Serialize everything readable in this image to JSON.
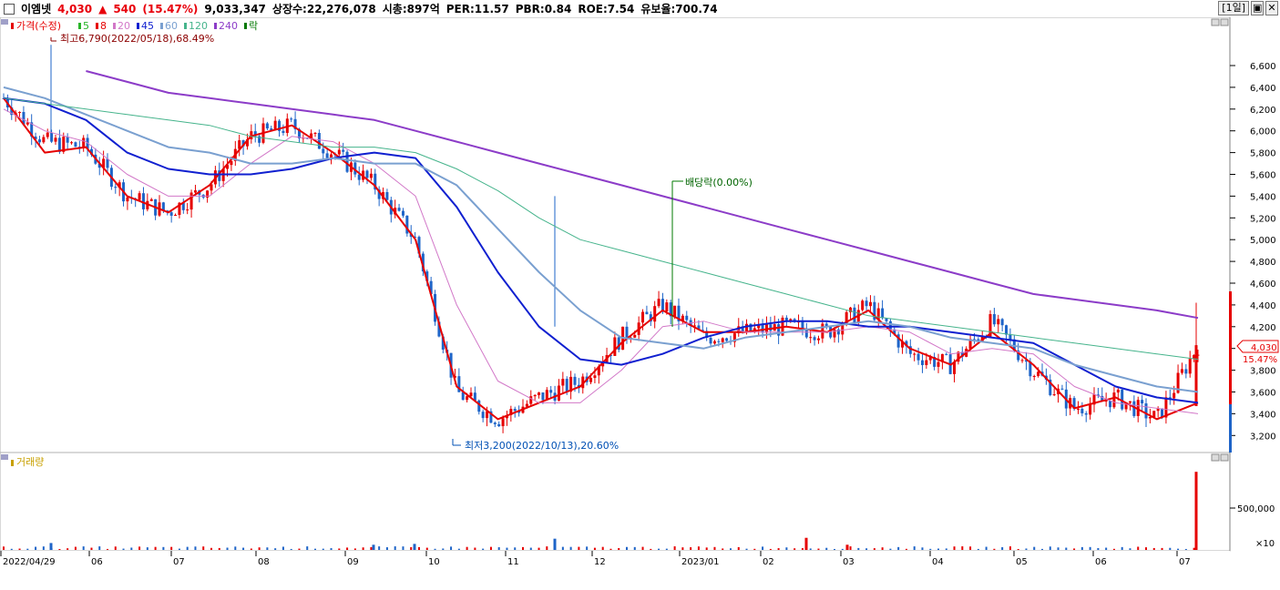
{
  "header": {
    "stock_name": "이엠넷",
    "price": "4,030",
    "change_arrow": "▲",
    "change": "540",
    "change_pct": "(15.47%)",
    "volume": "9,033,347",
    "listed_shares": "상장수:22,276,078",
    "market_cap": "시총:897억",
    "per": "PER:11.57",
    "pbr": "PBR:0.84",
    "roe": "ROE:7.54",
    "reserve_ratio": "유보율:700.74",
    "period_button": "[1일]",
    "restore_button": "▣",
    "close_button": "✕"
  },
  "legend": {
    "price_label": "가격(수정)",
    "ma_items": [
      {
        "label": "5",
        "color": "#28b428"
      },
      {
        "label": "8",
        "color": "#e60000"
      },
      {
        "label": "20",
        "color": "#d278c8"
      },
      {
        "label": "45",
        "color": "#1020d0"
      },
      {
        "label": "60",
        "color": "#7aa0d0"
      },
      {
        "label": "120",
        "color": "#46b48c"
      },
      {
        "label": "240",
        "color": "#8c3cc8"
      }
    ],
    "rak_label": "락",
    "volume_label": "거래량"
  },
  "annotations": {
    "high": "최고6,790(2022/05/18),68.49%",
    "low": "최저3,200(2022/10/13),20.60%",
    "dividend": "배당락(0.00%)"
  },
  "price_axis": {
    "ticks": [
      "6,600",
      "6,400",
      "6,200",
      "6,000",
      "5,800",
      "5,600",
      "5,400",
      "5,200",
      "5,000",
      "4,800",
      "4,600",
      "4,400",
      "4,200",
      "4,000",
      "3,800",
      "3,600",
      "3,400",
      "3,200"
    ],
    "current_tag": "4,030",
    "current_pct": "15.47%"
  },
  "volume_axis": {
    "tick": "500,000",
    "unit": "×10"
  },
  "x_axis": {
    "labels": [
      "2022/04/29",
      "06",
      "07",
      "08",
      "09",
      "10",
      "11",
      "12",
      "2023/01",
      "02",
      "03",
      "04",
      "05",
      "06",
      "07"
    ]
  },
  "chart_data": {
    "type": "candlestick",
    "ylim": [
      3100,
      6800
    ],
    "dates_start": "2022/04/29",
    "dates_end": "2023/07",
    "price_series": [
      {
        "date": "2022/04/29",
        "close": 6300
      },
      {
        "date": "2022/05/18",
        "close": 5900
      },
      {
        "date": "2022/06/01",
        "close": 5850
      },
      {
        "date": "2022/06/20",
        "close": 5400
      },
      {
        "date": "2022/07/05",
        "close": 5250
      },
      {
        "date": "2022/07/20",
        "close": 5500
      },
      {
        "date": "2022/08/01",
        "close": 5950
      },
      {
        "date": "2022/08/15",
        "close": 6050
      },
      {
        "date": "2022/09/01",
        "close": 5800
      },
      {
        "date": "2022/09/15",
        "close": 5500
      },
      {
        "date": "2022/09/25",
        "close": 5000
      },
      {
        "date": "2022/10/05",
        "close": 3600
      },
      {
        "date": "2022/10/13",
        "close": 3350
      },
      {
        "date": "2022/10/25",
        "close": 3550
      },
      {
        "date": "2022/11/10",
        "close": 3700
      },
      {
        "date": "2022/11/25",
        "close": 4100
      },
      {
        "date": "2022/12/10",
        "close": 4400
      },
      {
        "date": "2022/12/27",
        "close": 4100
      },
      {
        "date": "2023/01/15",
        "close": 4150
      },
      {
        "date": "2023/02/01",
        "close": 4200
      },
      {
        "date": "2023/02/20",
        "close": 4150
      },
      {
        "date": "2023/03/05",
        "close": 4400
      },
      {
        "date": "2023/03/20",
        "close": 3950
      },
      {
        "date": "2023/04/05",
        "close": 3850
      },
      {
        "date": "2023/04/15",
        "close": 4250
      },
      {
        "date": "2023/05/01",
        "close": 3800
      },
      {
        "date": "2023/05/20",
        "close": 3450
      },
      {
        "date": "2023/06/05",
        "close": 3550
      },
      {
        "date": "2023/06/25",
        "close": 3350
      },
      {
        "date": "2023/07/07",
        "close": 4030
      }
    ],
    "moving_averages": [
      {
        "name": "8",
        "color": "#e60000",
        "values": [
          6300,
          5800,
          5850,
          5400,
          5250,
          5500,
          5950,
          6050,
          5800,
          5500,
          5000,
          3650,
          3350,
          3500,
          3650,
          4050,
          4350,
          4150,
          4150,
          4200,
          4150,
          4350,
          4000,
          3850,
          4150,
          3850,
          3450,
          3550,
          3350,
          3500
        ]
      },
      {
        "name": "20",
        "color": "#d278c8",
        "values": [
          6200,
          6000,
          5900,
          5600,
          5400,
          5400,
          5700,
          5950,
          5900,
          5700,
          5400,
          4400,
          3700,
          3500,
          3500,
          3800,
          4200,
          4250,
          4150,
          4150,
          4150,
          4200,
          4150,
          3950,
          4000,
          3950,
          3650,
          3500,
          3450,
          3400
        ]
      },
      {
        "name": "45",
        "color": "#1020d0",
        "values": [
          6300,
          6250,
          6100,
          5800,
          5650,
          5600,
          5600,
          5650,
          5750,
          5800,
          5750,
          5300,
          4700,
          4200,
          3900,
          3850,
          3950,
          4100,
          4200,
          4250,
          4250,
          4200,
          4200,
          4150,
          4100,
          4050,
          3850,
          3650,
          3550,
          3500
        ]
      },
      {
        "name": "60",
        "color": "#7aa0d0",
        "values": [
          6400,
          6300,
          6150,
          6000,
          5850,
          5800,
          5700,
          5700,
          5750,
          5700,
          5700,
          5500,
          5100,
          4700,
          4350,
          4100,
          4050,
          4000,
          4100,
          4150,
          4200,
          4250,
          4200,
          4100,
          4050,
          4000,
          3850,
          3750,
          3650,
          3600
        ]
      },
      {
        "name": "120",
        "color": "#46b48c",
        "values": [
          6300,
          6250,
          6200,
          6150,
          6100,
          6050,
          5950,
          5900,
          5850,
          5850,
          5800,
          5650,
          5450,
          5200,
          5000,
          4900,
          4800,
          4700,
          4600,
          4500,
          4400,
          4300,
          4250,
          4200,
          4150,
          4100,
          4050,
          4000,
          3950,
          3900
        ]
      },
      {
        "name": "240",
        "color": "#8c3cc8",
        "values": [
          null,
          null,
          6550,
          6450,
          6350,
          6300,
          6250,
          6200,
          6150,
          6100,
          6000,
          5900,
          5800,
          5700,
          5600,
          5500,
          5400,
          5300,
          5200,
          5100,
          5000,
          4900,
          4800,
          4700,
          4600,
          4500,
          4450,
          4400,
          4350,
          4280
        ]
      }
    ],
    "volume_series": [
      {
        "date": "2022/05/18",
        "volume": 80000
      },
      {
        "date": "2022/09/20",
        "volume": 60000
      },
      {
        "date": "2022/10/05",
        "volume": 70000
      },
      {
        "date": "2022/11/25",
        "volume": 130000
      },
      {
        "date": "2023/02/20",
        "volume": 140000
      },
      {
        "date": "2023/03/05",
        "volume": 60000
      },
      {
        "date": "2023/07/07",
        "volume": 903335
      }
    ]
  }
}
